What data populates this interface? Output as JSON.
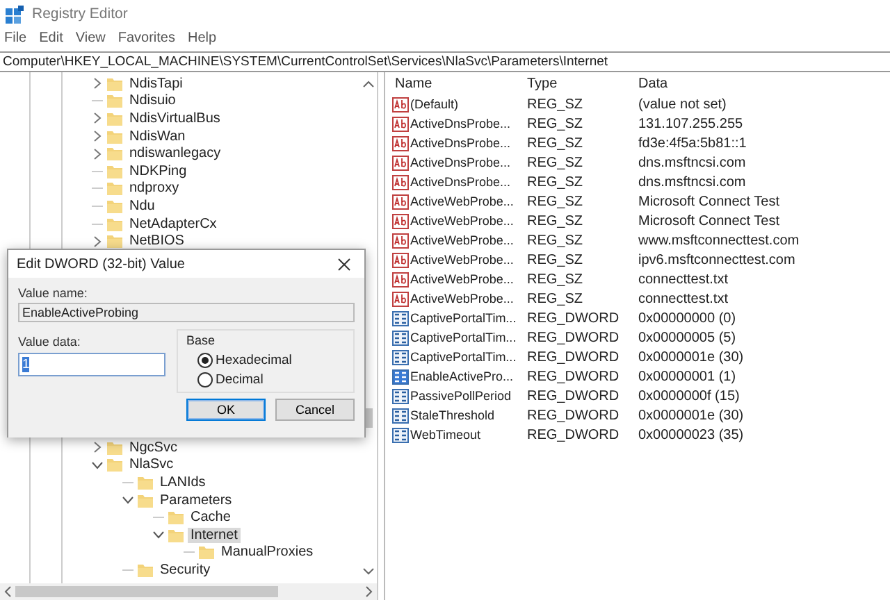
{
  "window": {
    "title": "Registry Editor"
  },
  "menu": [
    "File",
    "Edit",
    "View",
    "Favorites",
    "Help"
  ],
  "address": "Computer\\HKEY_LOCAL_MACHINE\\SYSTEM\\CurrentControlSet\\Services\\NlaSvc\\Parameters\\Internet",
  "tree": {
    "groups": [
      {
        "items": [
          {
            "label": "NdisTapi",
            "kind": "collapsed",
            "selected": false
          },
          {
            "label": "Ndisuio",
            "kind": "leaf",
            "selected": false
          },
          {
            "label": "NdisVirtualBus",
            "kind": "collapsed",
            "selected": false
          },
          {
            "label": "NdisWan",
            "kind": "collapsed",
            "selected": false
          },
          {
            "label": "ndiswanlegacy",
            "kind": "collapsed",
            "selected": false
          },
          {
            "label": "NDKPing",
            "kind": "leaf",
            "selected": false
          },
          {
            "label": "ndproxy",
            "kind": "leaf",
            "selected": false
          },
          {
            "label": "Ndu",
            "kind": "leaf",
            "selected": false
          },
          {
            "label": "NetAdapterCx",
            "kind": "leaf",
            "selected": false
          },
          {
            "label": "NetBIOS",
            "kind": "collapsed",
            "selected": false
          }
        ]
      },
      {
        "items": [
          {
            "label": "NgcSvc",
            "kind": "collapsed",
            "selected": false
          },
          {
            "label": "NlaSvc",
            "kind": "expanded",
            "selected": false,
            "children": [
              {
                "label": "LANIds",
                "kind": "leaf",
                "selected": false
              },
              {
                "label": "Parameters",
                "kind": "expanded",
                "selected": false,
                "children": [
                  {
                    "label": "Cache",
                    "kind": "leaf",
                    "selected": false
                  },
                  {
                    "label": "Internet",
                    "kind": "expanded",
                    "selected": true,
                    "children": [
                      {
                        "label": "ManualProxies",
                        "kind": "leaf",
                        "selected": false
                      }
                    ]
                  }
                ]
              },
              {
                "label": "Security",
                "kind": "leaf",
                "selected": false
              }
            ]
          }
        ]
      }
    ]
  },
  "table": {
    "columns": [
      "Name",
      "Type",
      "Data"
    ],
    "rows": [
      {
        "name": "(Default)",
        "type": "REG_SZ",
        "data": "(value not set)",
        "kind": "string",
        "selected": false
      },
      {
        "name": "ActiveDnsProbe...",
        "type": "REG_SZ",
        "data": "131.107.255.255",
        "kind": "string",
        "selected": false
      },
      {
        "name": "ActiveDnsProbe...",
        "type": "REG_SZ",
        "data": "fd3e:4f5a:5b81::1",
        "kind": "string",
        "selected": false
      },
      {
        "name": "ActiveDnsProbe...",
        "type": "REG_SZ",
        "data": "dns.msftncsi.com",
        "kind": "string",
        "selected": false
      },
      {
        "name": "ActiveDnsProbe...",
        "type": "REG_SZ",
        "data": "dns.msftncsi.com",
        "kind": "string",
        "selected": false
      },
      {
        "name": "ActiveWebProbe...",
        "type": "REG_SZ",
        "data": "Microsoft Connect Test",
        "kind": "string",
        "selected": false
      },
      {
        "name": "ActiveWebProbe...",
        "type": "REG_SZ",
        "data": "Microsoft Connect Test",
        "kind": "string",
        "selected": false
      },
      {
        "name": "ActiveWebProbe...",
        "type": "REG_SZ",
        "data": "www.msftconnecttest.com",
        "kind": "string",
        "selected": false
      },
      {
        "name": "ActiveWebProbe...",
        "type": "REG_SZ",
        "data": "ipv6.msftconnecttest.com",
        "kind": "string",
        "selected": false
      },
      {
        "name": "ActiveWebProbe...",
        "type": "REG_SZ",
        "data": "connecttest.txt",
        "kind": "string",
        "selected": false
      },
      {
        "name": "ActiveWebProbe...",
        "type": "REG_SZ",
        "data": "connecttest.txt",
        "kind": "string",
        "selected": false
      },
      {
        "name": "CaptivePortalTim...",
        "type": "REG_DWORD",
        "data": "0x00000000 (0)",
        "kind": "dword",
        "selected": false
      },
      {
        "name": "CaptivePortalTim...",
        "type": "REG_DWORD",
        "data": "0x00000005 (5)",
        "kind": "dword",
        "selected": false
      },
      {
        "name": "CaptivePortalTim...",
        "type": "REG_DWORD",
        "data": "0x0000001e (30)",
        "kind": "dword",
        "selected": false
      },
      {
        "name": "EnableActivePro...",
        "type": "REG_DWORD",
        "data": "0x00000001 (1)",
        "kind": "dword",
        "selected": true
      },
      {
        "name": "PassivePollPeriod",
        "type": "REG_DWORD",
        "data": "0x0000000f (15)",
        "kind": "dword",
        "selected": false
      },
      {
        "name": "StaleThreshold",
        "type": "REG_DWORD",
        "data": "0x0000001e (30)",
        "kind": "dword",
        "selected": false
      },
      {
        "name": "WebTimeout",
        "type": "REG_DWORD",
        "data": "0x00000023 (35)",
        "kind": "dword",
        "selected": false
      }
    ]
  },
  "dialog": {
    "title": "Edit DWORD (32-bit) Value",
    "value_name_label": "Value name:",
    "value_name": "EnableActiveProbing",
    "value_data_label": "Value data:",
    "value_data": "1",
    "base_label": "Base",
    "bases": [
      {
        "label": "Hexadecimal",
        "selected": true
      },
      {
        "label": "Decimal",
        "selected": false
      }
    ],
    "buttons": [
      {
        "label": "OK",
        "focused": true
      },
      {
        "label": "Cancel",
        "focused": false
      }
    ]
  }
}
